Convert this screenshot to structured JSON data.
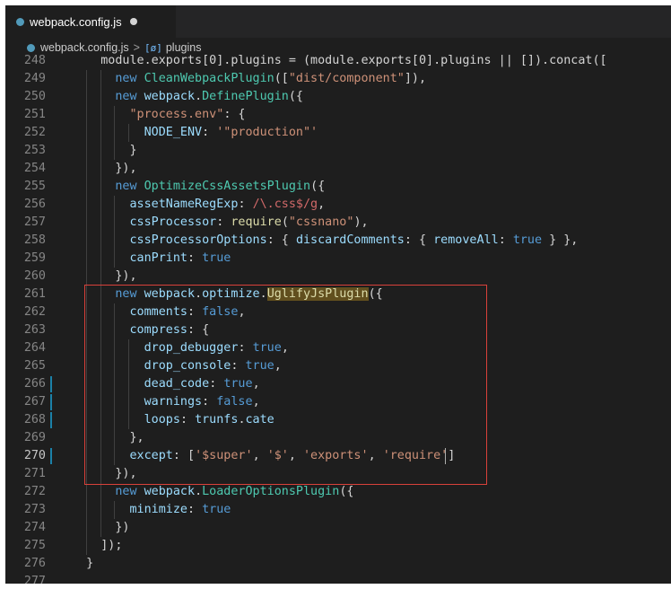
{
  "tab": {
    "title": "webpack.config.js",
    "icon": "js-file-icon"
  },
  "breadcrumb": {
    "file": "webpack.config.js",
    "separator": ">",
    "symbol_glyph": "[ø]",
    "symbol": "plugins"
  },
  "cursor_line": 270,
  "lines": [
    {
      "n": "248",
      "tokens": [
        {
          "t": "    module.exports[0].plugins = (module.exports[0].plugins || []).concat([",
          "c": "t-plain"
        }
      ]
    },
    {
      "n": "249",
      "tokens": [
        {
          "t": "      ",
          "c": "t-plain"
        },
        {
          "t": "new ",
          "c": "t-kw"
        },
        {
          "t": "CleanWebpackPlugin",
          "c": "t-cls"
        },
        {
          "t": "([",
          "c": "t-plain"
        },
        {
          "t": "\"dist/component\"",
          "c": "t-str"
        },
        {
          "t": "]),",
          "c": "t-plain"
        }
      ]
    },
    {
      "n": "250",
      "tokens": [
        {
          "t": "      ",
          "c": "t-plain"
        },
        {
          "t": "new ",
          "c": "t-kw"
        },
        {
          "t": "webpack",
          "c": "t-prop"
        },
        {
          "t": ".",
          "c": "t-plain"
        },
        {
          "t": "DefinePlugin",
          "c": "t-cls"
        },
        {
          "t": "({",
          "c": "t-plain"
        }
      ]
    },
    {
      "n": "251",
      "tokens": [
        {
          "t": "        ",
          "c": "t-plain"
        },
        {
          "t": "\"process.env\"",
          "c": "t-str"
        },
        {
          "t": ": {",
          "c": "t-plain"
        }
      ]
    },
    {
      "n": "252",
      "tokens": [
        {
          "t": "          ",
          "c": "t-plain"
        },
        {
          "t": "NODE_ENV",
          "c": "t-prop"
        },
        {
          "t": ": ",
          "c": "t-plain"
        },
        {
          "t": "'\"production\"'",
          "c": "t-str"
        }
      ]
    },
    {
      "n": "253",
      "tokens": [
        {
          "t": "        }",
          "c": "t-plain"
        }
      ]
    },
    {
      "n": "254",
      "tokens": [
        {
          "t": "      }),",
          "c": "t-plain"
        }
      ]
    },
    {
      "n": "255",
      "tokens": [
        {
          "t": "      ",
          "c": "t-plain"
        },
        {
          "t": "new ",
          "c": "t-kw"
        },
        {
          "t": "OptimizeCssAssetsPlugin",
          "c": "t-cls"
        },
        {
          "t": "({",
          "c": "t-plain"
        }
      ]
    },
    {
      "n": "256",
      "tokens": [
        {
          "t": "        ",
          "c": "t-plain"
        },
        {
          "t": "assetNameRegExp",
          "c": "t-prop"
        },
        {
          "t": ": ",
          "c": "t-plain"
        },
        {
          "t": "/\\.css$/g",
          "c": "t-re"
        },
        {
          "t": ",",
          "c": "t-plain"
        }
      ]
    },
    {
      "n": "257",
      "tokens": [
        {
          "t": "        ",
          "c": "t-plain"
        },
        {
          "t": "cssProcessor",
          "c": "t-prop"
        },
        {
          "t": ": ",
          "c": "t-plain"
        },
        {
          "t": "require",
          "c": "t-fn"
        },
        {
          "t": "(",
          "c": "t-plain"
        },
        {
          "t": "\"cssnano\"",
          "c": "t-str"
        },
        {
          "t": "),",
          "c": "t-plain"
        }
      ]
    },
    {
      "n": "258",
      "tokens": [
        {
          "t": "        ",
          "c": "t-plain"
        },
        {
          "t": "cssProcessorOptions",
          "c": "t-prop"
        },
        {
          "t": ": { ",
          "c": "t-plain"
        },
        {
          "t": "discardComments",
          "c": "t-prop"
        },
        {
          "t": ": { ",
          "c": "t-plain"
        },
        {
          "t": "removeAll",
          "c": "t-prop"
        },
        {
          "t": ": ",
          "c": "t-plain"
        },
        {
          "t": "true",
          "c": "t-kw"
        },
        {
          "t": " } },",
          "c": "t-plain"
        }
      ]
    },
    {
      "n": "259",
      "tokens": [
        {
          "t": "        ",
          "c": "t-plain"
        },
        {
          "t": "canPrint",
          "c": "t-prop"
        },
        {
          "t": ": ",
          "c": "t-plain"
        },
        {
          "t": "true",
          "c": "t-kw"
        }
      ]
    },
    {
      "n": "260",
      "tokens": [
        {
          "t": "      }),",
          "c": "t-plain"
        }
      ]
    },
    {
      "n": "261",
      "tokens": [
        {
          "t": "      ",
          "c": "t-plain"
        },
        {
          "t": "new ",
          "c": "t-kw"
        },
        {
          "t": "webpack",
          "c": "t-prop"
        },
        {
          "t": ".",
          "c": "t-plain"
        },
        {
          "t": "optimize",
          "c": "t-prop"
        },
        {
          "t": ".",
          "c": "t-plain"
        },
        {
          "t": "UglifyJsPlugin",
          "c": "t-hl"
        },
        {
          "t": "({",
          "c": "t-plain"
        }
      ]
    },
    {
      "n": "262",
      "tokens": [
        {
          "t": "        ",
          "c": "t-plain"
        },
        {
          "t": "comments",
          "c": "t-prop"
        },
        {
          "t": ": ",
          "c": "t-plain"
        },
        {
          "t": "false",
          "c": "t-kw"
        },
        {
          "t": ",",
          "c": "t-plain"
        }
      ]
    },
    {
      "n": "263",
      "tokens": [
        {
          "t": "        ",
          "c": "t-plain"
        },
        {
          "t": "compress",
          "c": "t-prop"
        },
        {
          "t": ": {",
          "c": "t-plain"
        }
      ]
    },
    {
      "n": "264",
      "tokens": [
        {
          "t": "          ",
          "c": "t-plain"
        },
        {
          "t": "drop_debugger",
          "c": "t-prop"
        },
        {
          "t": ": ",
          "c": "t-plain"
        },
        {
          "t": "true",
          "c": "t-kw"
        },
        {
          "t": ",",
          "c": "t-plain"
        }
      ]
    },
    {
      "n": "265",
      "tokens": [
        {
          "t": "          ",
          "c": "t-plain"
        },
        {
          "t": "drop_console",
          "c": "t-prop"
        },
        {
          "t": ": ",
          "c": "t-plain"
        },
        {
          "t": "true",
          "c": "t-kw"
        },
        {
          "t": ",",
          "c": "t-plain"
        }
      ]
    },
    {
      "n": "266",
      "tokens": [
        {
          "t": "          ",
          "c": "t-plain"
        },
        {
          "t": "dead_code",
          "c": "t-prop"
        },
        {
          "t": ": ",
          "c": "t-plain"
        },
        {
          "t": "true",
          "c": "t-kw"
        },
        {
          "t": ",",
          "c": "t-plain"
        }
      ]
    },
    {
      "n": "267",
      "tokens": [
        {
          "t": "          ",
          "c": "t-plain"
        },
        {
          "t": "warnings",
          "c": "t-prop"
        },
        {
          "t": ": ",
          "c": "t-plain"
        },
        {
          "t": "false",
          "c": "t-kw"
        },
        {
          "t": ",",
          "c": "t-plain"
        }
      ]
    },
    {
      "n": "268",
      "tokens": [
        {
          "t": "          ",
          "c": "t-plain"
        },
        {
          "t": "loops",
          "c": "t-prop"
        },
        {
          "t": ": ",
          "c": "t-plain"
        },
        {
          "t": "trunfs",
          "c": "t-prop"
        },
        {
          "t": ".",
          "c": "t-plain"
        },
        {
          "t": "cate",
          "c": "t-prop"
        }
      ]
    },
    {
      "n": "269",
      "tokens": [
        {
          "t": "        },",
          "c": "t-plain"
        }
      ]
    },
    {
      "n": "270",
      "tokens": [
        {
          "t": "        ",
          "c": "t-plain"
        },
        {
          "t": "except",
          "c": "t-prop"
        },
        {
          "t": ": [",
          "c": "t-plain"
        },
        {
          "t": "'$super'",
          "c": "t-str"
        },
        {
          "t": ", ",
          "c": "t-plain"
        },
        {
          "t": "'$'",
          "c": "t-str"
        },
        {
          "t": ", ",
          "c": "t-plain"
        },
        {
          "t": "'exports'",
          "c": "t-str"
        },
        {
          "t": ", ",
          "c": "t-plain"
        },
        {
          "t": "'require'",
          "c": "t-str"
        },
        {
          "t": "]",
          "c": "t-plain"
        }
      ]
    },
    {
      "n": "271",
      "tokens": [
        {
          "t": "      }),",
          "c": "t-plain"
        }
      ]
    },
    {
      "n": "272",
      "tokens": [
        {
          "t": "      ",
          "c": "t-plain"
        },
        {
          "t": "new ",
          "c": "t-kw"
        },
        {
          "t": "webpack",
          "c": "t-prop"
        },
        {
          "t": ".",
          "c": "t-plain"
        },
        {
          "t": "LoaderOptionsPlugin",
          "c": "t-cls"
        },
        {
          "t": "({",
          "c": "t-plain"
        }
      ]
    },
    {
      "n": "273",
      "tokens": [
        {
          "t": "        ",
          "c": "t-plain"
        },
        {
          "t": "minimize",
          "c": "t-prop"
        },
        {
          "t": ": ",
          "c": "t-plain"
        },
        {
          "t": "true",
          "c": "t-kw"
        }
      ]
    },
    {
      "n": "274",
      "tokens": [
        {
          "t": "      })",
          "c": "t-plain"
        }
      ]
    },
    {
      "n": "275",
      "tokens": [
        {
          "t": "    ]);",
          "c": "t-plain"
        }
      ]
    },
    {
      "n": "276",
      "tokens": [
        {
          "t": "  }",
          "c": "t-plain"
        }
      ]
    },
    {
      "n": "277",
      "tokens": []
    }
  ],
  "modified_lines": [
    266,
    267,
    268,
    270
  ],
  "colors": {
    "background": "#1e1e1e",
    "annotation_box": "#d9413a",
    "modified_marker": "#1b81a8"
  }
}
